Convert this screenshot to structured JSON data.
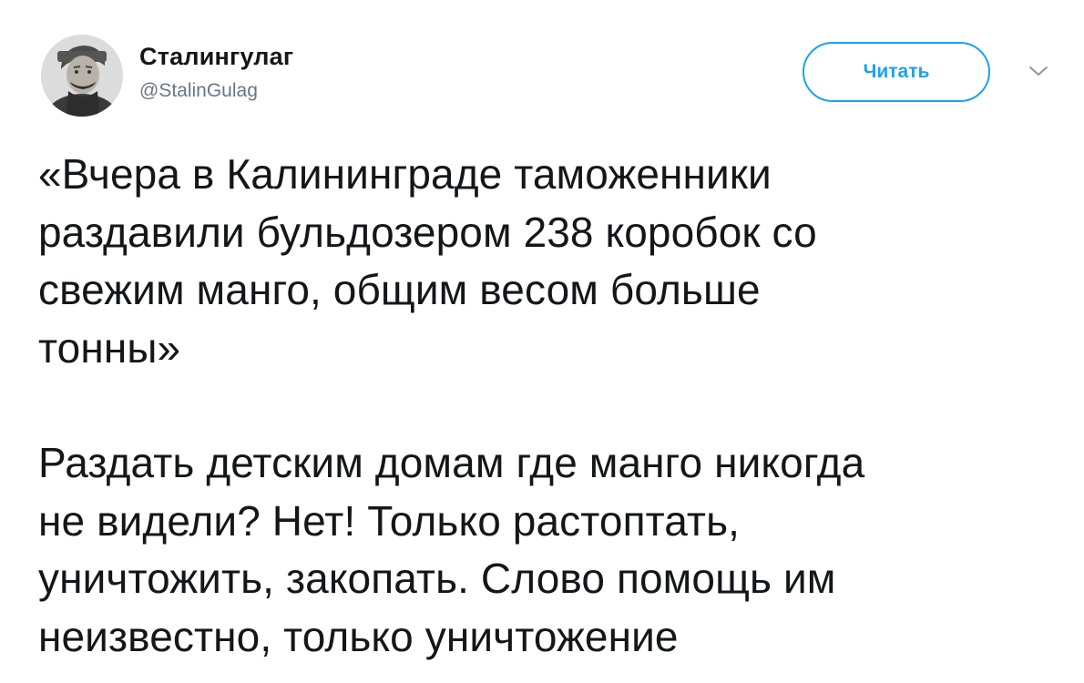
{
  "tweet": {
    "author": {
      "display_name": "Сталингулаг",
      "handle": "@StalinGulag",
      "avatar_icon": "portrait-avatar-icon"
    },
    "follow_button_label": "Читать",
    "menu_icon": "chevron-down-icon",
    "paragraphs": [
      "«Вчера в Калининграде таможенники\nраздавили бульдозером 238 коробок со\nсвежим манго, общим весом больше\nтонны»",
      "Раздать детским домам где манго никогда\nне видели? Нет! Только растоптать,\nуничтожить, закопать. Слово помощь им\nнеизвестно, только уничтожение"
    ]
  },
  "colors": {
    "accent": "#1da1f2",
    "text": "#14171a",
    "secondary_text": "#657786",
    "background": "#ffffff"
  }
}
